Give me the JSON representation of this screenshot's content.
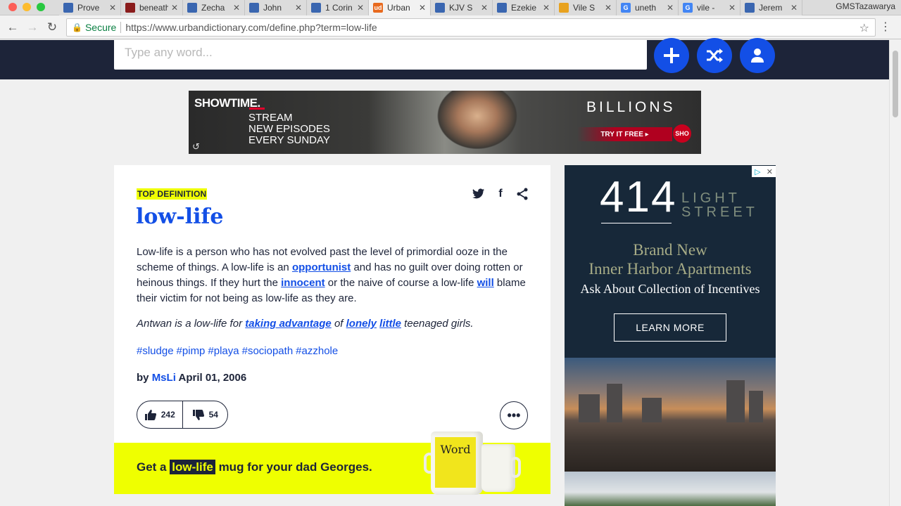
{
  "browser": {
    "tabs": [
      {
        "title": "Prove",
        "favicon_color": "#3a66b0",
        "active": false
      },
      {
        "title": "beneath",
        "favicon_color": "#8a1c1c",
        "active": false
      },
      {
        "title": "Zecha",
        "favicon_color": "#3a66b0",
        "active": false
      },
      {
        "title": "John",
        "favicon_color": "#3a66b0",
        "active": false
      },
      {
        "title": "1 Corin",
        "favicon_color": "#3a66b0",
        "active": false
      },
      {
        "title": "Urban",
        "favicon_color": "#e86a1f",
        "favicon_text": "ud",
        "active": true
      },
      {
        "title": "KJV S",
        "favicon_color": "#3a66b0",
        "active": false
      },
      {
        "title": "Ezekie",
        "favicon_color": "#3a66b0",
        "active": false
      },
      {
        "title": "Vile S",
        "favicon_color": "#e8a21f",
        "active": false
      },
      {
        "title": "uneth",
        "favicon_color": "#4285f4",
        "favicon_text": "G",
        "active": false
      },
      {
        "title": "vile -",
        "favicon_color": "#4285f4",
        "favicon_text": "G",
        "active": false
      },
      {
        "title": "Jerem",
        "favicon_color": "#3a66b0",
        "active": false
      }
    ],
    "profile_name": "GMSTazawarya",
    "secure_label": "Secure",
    "url": "https://www.urbandictionary.com/define.php?term=low-life"
  },
  "header": {
    "search_placeholder": "Type any word...",
    "buttons": [
      {
        "name": "add-definition-button",
        "glyph": "+"
      },
      {
        "name": "random-button",
        "glyph": "⤨"
      },
      {
        "name": "account-button",
        "glyph": "👤"
      }
    ]
  },
  "banner_ad": {
    "network": "SHOWTIME.",
    "lines": [
      "STREAM",
      "NEW EPISODES",
      "EVERY SUNDAY"
    ],
    "show": "BILLIONS",
    "cta": "TRY IT FREE ▸",
    "badge": "SHO"
  },
  "definition": {
    "label": "TOP DEFINITION",
    "word": "low-life",
    "meaning_parts": [
      {
        "text": "Low-life is a person who has not evolved past the level of primordial ooze in the scheme of things. A low-life is an ",
        "link": false
      },
      {
        "text": "opportunist",
        "link": true
      },
      {
        "text": " and has no guilt over doing rotten or heinous things. If they hurt the ",
        "link": false
      },
      {
        "text": "innocent",
        "link": true
      },
      {
        "text": " or the naive of course a low-life ",
        "link": false
      },
      {
        "text": "will",
        "link": true
      },
      {
        "text": " blame their victim for not being as low-life as they are.",
        "link": false
      }
    ],
    "example_parts": [
      {
        "text": "Antwan is a low-life for ",
        "link": false
      },
      {
        "text": "taking advantage",
        "link": true
      },
      {
        "text": " of ",
        "link": false
      },
      {
        "text": "lonely",
        "link": true
      },
      {
        "text": " ",
        "link": false
      },
      {
        "text": "little",
        "link": true
      },
      {
        "text": " teenaged girls.",
        "link": false
      }
    ],
    "tags": [
      "#sludge",
      "#pimp",
      "#playa",
      "#sociopath",
      "#azzhole"
    ],
    "by_label": "by",
    "author": "MsLi",
    "date": "April 01, 2006",
    "upvotes": "242",
    "downvotes": "54",
    "more_glyph": "•••"
  },
  "mug_promo": {
    "prefix": "Get a",
    "word": "low-life",
    "suffix": "mug for your dad Georges.",
    "mug_face": "Word"
  },
  "side_ad": {
    "number": "414",
    "street_line1": "LIGHT",
    "street_line2": "STREET",
    "headline_line1": "Brand New",
    "headline_line2": "Inner Harbor Apartments",
    "subline": "Ask About Collection of Incentives",
    "cta": "LEARN MORE"
  },
  "colors": {
    "ud_navy": "#1d2439",
    "ud_blue": "#134fe6",
    "ud_yellow": "#efff00"
  }
}
